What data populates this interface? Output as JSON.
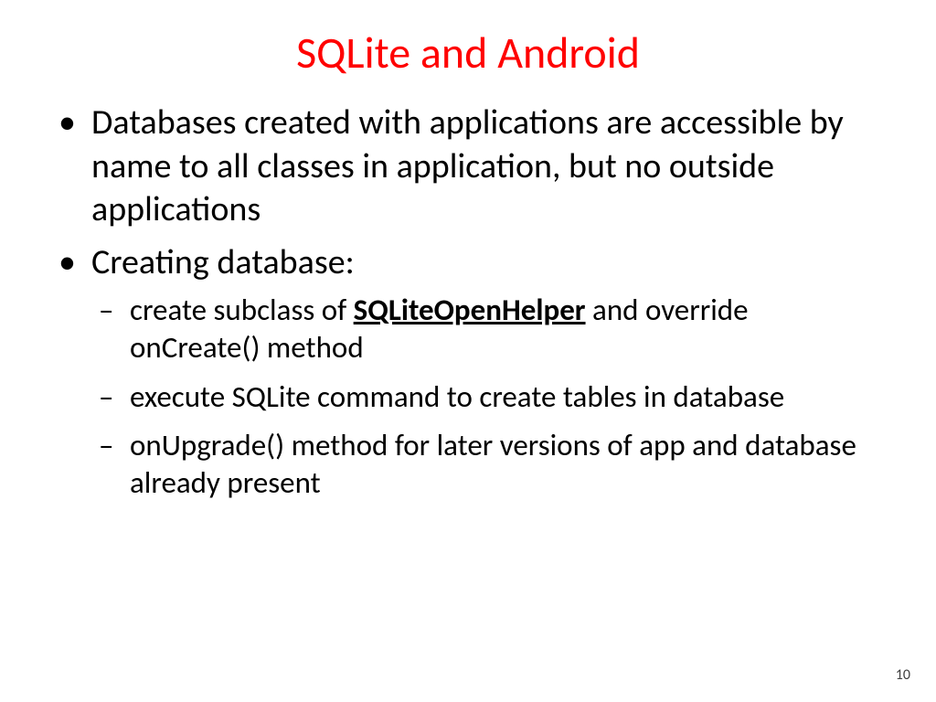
{
  "title": "SQLite and Android",
  "bullets": {
    "b1": "Databases created with applications are accessible by name to all classes in application, but no outside applications",
    "b2": "Creating database:",
    "sub": {
      "s1_pre": "create subclass of ",
      "s1_bold": "SQLiteOpenHelper",
      "s1_post": " and override onCreate() method",
      "s2": "execute SQLite command to create tables in database",
      "s3": "onUpgrade() method for later versions of app and database already present"
    }
  },
  "page_number": "10"
}
